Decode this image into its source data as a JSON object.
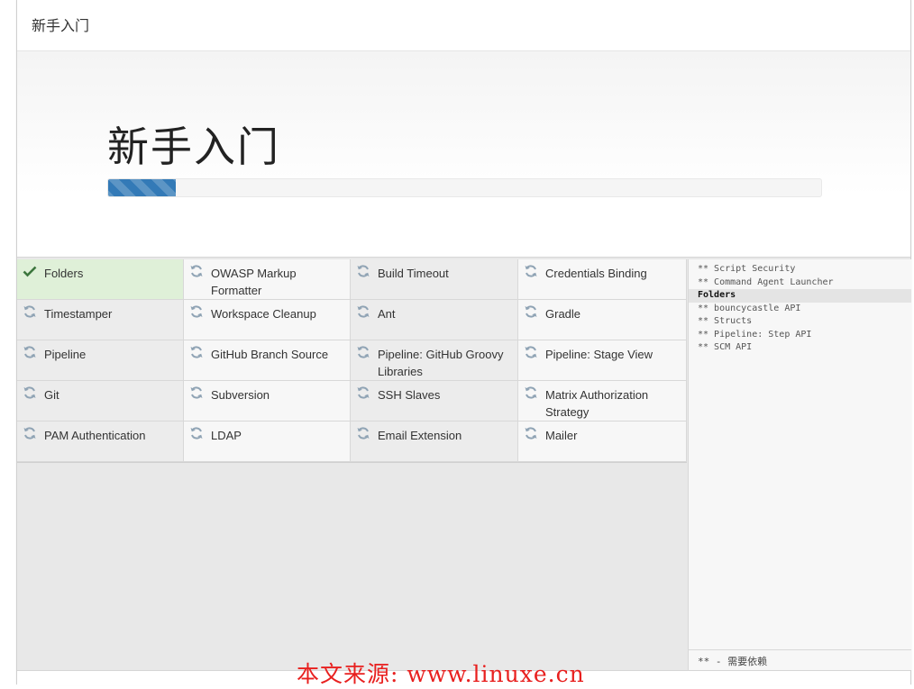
{
  "dialog": {
    "title": "新手入门"
  },
  "hero": {
    "title": "新手入门",
    "progress_fraction": 0.095
  },
  "plugins": [
    {
      "name": "Folders",
      "status": "done"
    },
    {
      "name": "OWASP Markup Formatter",
      "status": "pending"
    },
    {
      "name": "Build Timeout",
      "status": "pending"
    },
    {
      "name": "Credentials Binding",
      "status": "pending"
    },
    {
      "name": "Timestamper",
      "status": "pending"
    },
    {
      "name": "Workspace Cleanup",
      "status": "pending"
    },
    {
      "name": "Ant",
      "status": "pending"
    },
    {
      "name": "Gradle",
      "status": "pending"
    },
    {
      "name": "Pipeline",
      "status": "pending"
    },
    {
      "name": "GitHub Branch Source",
      "status": "pending"
    },
    {
      "name": "Pipeline: GitHub Groovy Libraries",
      "status": "pending"
    },
    {
      "name": "Pipeline: Stage View",
      "status": "pending"
    },
    {
      "name": "Git",
      "status": "pending"
    },
    {
      "name": "Subversion",
      "status": "pending"
    },
    {
      "name": "SSH Slaves",
      "status": "pending"
    },
    {
      "name": "Matrix Authorization Strategy",
      "status": "pending"
    },
    {
      "name": "PAM Authentication",
      "status": "pending"
    },
    {
      "name": "LDAP",
      "status": "pending"
    },
    {
      "name": "Email Extension",
      "status": "pending"
    },
    {
      "name": "Mailer",
      "status": "pending"
    }
  ],
  "log": {
    "lines": [
      {
        "text": "** Script Security",
        "current": false
      },
      {
        "text": "** Command Agent Launcher",
        "current": false
      },
      {
        "text": "Folders",
        "current": true
      },
      {
        "text": "** bouncycastle API",
        "current": false
      },
      {
        "text": "** Structs",
        "current": false
      },
      {
        "text": "** Pipeline: Step API",
        "current": false
      },
      {
        "text": "** SCM API",
        "current": false
      }
    ],
    "footer": "** - 需要依赖"
  },
  "watermark": "本文来源: www.linuxe.cn",
  "colors": {
    "progress": "#337ab7",
    "done_bg": "#dff0d8",
    "check": "#3c763d",
    "spinner": "#8fa3b4",
    "watermark": "#e8201f"
  },
  "icons": {
    "done": "check-icon",
    "pending": "refresh-icon"
  }
}
